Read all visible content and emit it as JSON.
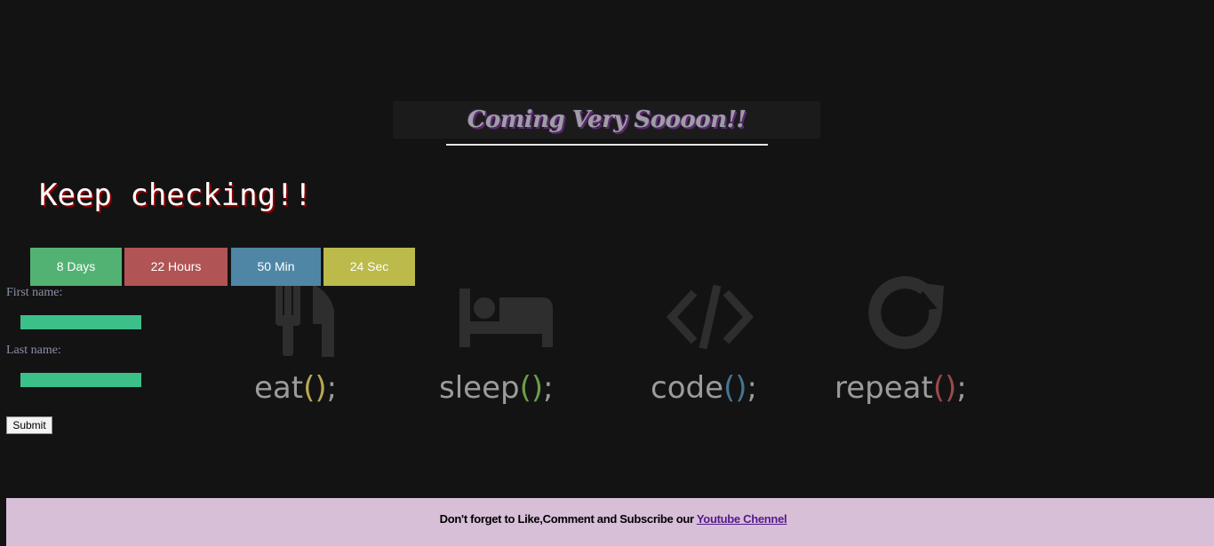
{
  "header": {
    "title": "Coming Very Soooon!!"
  },
  "headline": "Keep checking!!",
  "countdown": [
    {
      "label": "8 Days",
      "color": "#52b274"
    },
    {
      "label": "22 Hours",
      "color": "#b15455"
    },
    {
      "label": "50 Min",
      "color": "#4f86a5"
    },
    {
      "label": "24 Sec",
      "color": "#bbba4a"
    }
  ],
  "background_art": {
    "words": [
      "eat",
      "sleep",
      "code",
      "repeat"
    ],
    "suffix_open": "(",
    "suffix_close": ");",
    "paren_colors": [
      "#d6c45a",
      "#7ab851",
      "#4f86a5",
      "#b15455"
    ],
    "icons": [
      "fork-knife-icon",
      "bed-icon",
      "code-icon",
      "refresh-icon"
    ]
  },
  "form": {
    "first_name_label": "First name:",
    "first_name_value": "",
    "last_name_label": "Last name:",
    "last_name_value": "",
    "submit_label": "Submit"
  },
  "footer": {
    "text": "Don't forget to Like,Comment and Subscribe our",
    "link_text": "Youtube Chennel",
    "background": "#d8bfd8"
  }
}
